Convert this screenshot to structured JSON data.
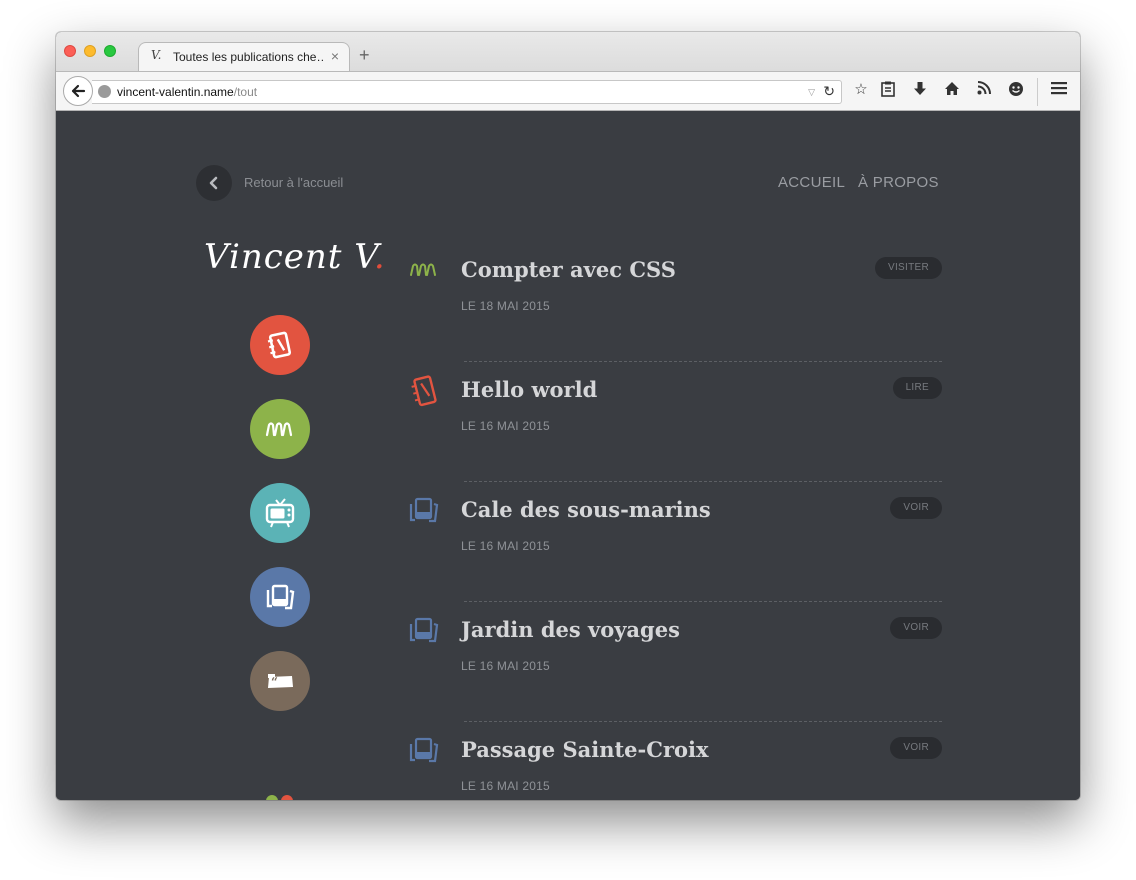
{
  "browser": {
    "tab_favicon": "V.",
    "tab_title": "Toutes les publications che…",
    "tab_close": "×",
    "new_tab": "+",
    "url_host": "vincent-valentin.name",
    "url_path": "/tout",
    "toolbar_icons": [
      "star-icon",
      "reading-list-icon",
      "download-icon",
      "home-icon",
      "rss-icon",
      "emoji-icon",
      "menu-icon"
    ]
  },
  "header": {
    "back_label": "Retour à l'accueil",
    "nav": [
      "ACCUEIL",
      "À PROPOS"
    ]
  },
  "logo": {
    "text": "Vincent V",
    "dot": "."
  },
  "categories": [
    {
      "icon": "notebook-icon",
      "color": "#e25440"
    },
    {
      "icon": "code-icon",
      "color": "#8db34a"
    },
    {
      "icon": "tv-icon",
      "color": "#5bb3b6"
    },
    {
      "icon": "photos-icon",
      "color": "#5a78a8"
    },
    {
      "icon": "quote-icon",
      "color": "#7a6a5b"
    }
  ],
  "posts": [
    {
      "title": "Compter avec CSS",
      "date": "LE 18 MAI 2015",
      "action": "VISITER",
      "icon": "code-icon",
      "color": "#8db34a"
    },
    {
      "title": "Hello world",
      "date": "LE 16 MAI 2015",
      "action": "LIRE",
      "icon": "notebook-icon",
      "color": "#e25440"
    },
    {
      "title": "Cale des sous-marins",
      "date": "LE 16 MAI 2015",
      "action": "VOIR",
      "icon": "photos-icon",
      "color": "#5a78a8"
    },
    {
      "title": "Jardin des voyages",
      "date": "LE 16 MAI 2015",
      "action": "VOIR",
      "icon": "photos-icon",
      "color": "#5a78a8"
    },
    {
      "title": "Passage Sainte-Croix",
      "date": "LE 16 MAI 2015",
      "action": "VOIR",
      "icon": "photos-icon",
      "color": "#5a78a8"
    }
  ]
}
